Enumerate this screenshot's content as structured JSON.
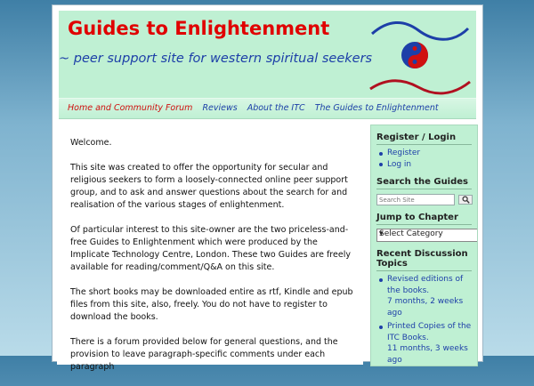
{
  "header": {
    "title": "Guides to Enlightenment",
    "tagline": "~ peer support site for western spiritual seekers"
  },
  "colors": {
    "title_red": "#e00000",
    "link_blue": "#1d3fa8",
    "mint_green": "#bff0d3"
  },
  "nav": {
    "items": [
      {
        "label": "Home and Community Forum"
      },
      {
        "label": "Reviews"
      },
      {
        "label": "About the ITC"
      },
      {
        "label": "The Guides to Enlightenment"
      }
    ]
  },
  "content": {
    "paragraphs": [
      "Welcome.",
      "This site was created to offer the opportunity for secular and religious seekers to form a loosely-connected online peer support group, and to ask and answer questions about the search for and realisation of the various stages of enlightenment.",
      "Of particular interest to this site-owner are the two priceless-and-free Guides to Enlightenment which were produced by the Implicate Technology Centre, London. These two Guides are freely available for reading/comment/Q&A on this site.",
      "The short books may be downloaded entire as rtf, Kindle and epub files from this site, also, freely. You do not have to register to download the books.",
      "There is a forum provided below for general questions, and the provision to leave paragraph-specific comments under each paragraph"
    ]
  },
  "sidebar": {
    "register": {
      "title": "Register / Login",
      "items": [
        {
          "label": "Register"
        },
        {
          "label": "Log in"
        }
      ]
    },
    "search": {
      "title": "Search the Guides",
      "placeholder": "Search Site",
      "icon": "magnifier-icon"
    },
    "chapter": {
      "title": "Jump to Chapter",
      "selected": "Select Category"
    },
    "discussion": {
      "title": "Recent Discussion Topics",
      "items": [
        {
          "label": "Revised editions of the books.",
          "meta": "7 months, 2 weeks ago"
        },
        {
          "label": "Printed Copies of the ITC Books.",
          "meta": "11 months, 3 weeks ago"
        }
      ]
    }
  }
}
